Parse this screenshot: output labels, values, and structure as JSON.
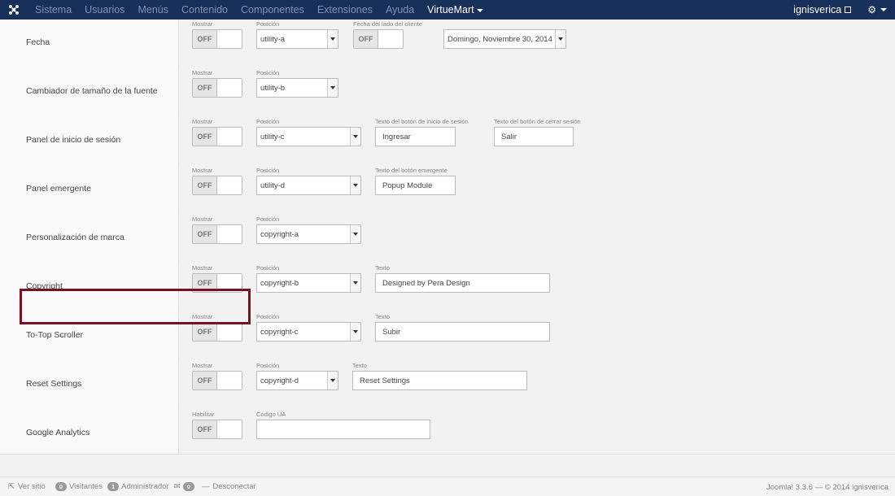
{
  "navbar": {
    "items": [
      "Sistema",
      "Usuarios",
      "Menús",
      "Contenido",
      "Componentes",
      "Extensiones",
      "Ayuda"
    ],
    "active_item": "VirtueMart",
    "user": "ignisverica",
    "bg": "#17305a"
  },
  "labels": {
    "mostrar": "Mostrar",
    "posicion": "Posición",
    "texto": "Texto",
    "habilitar": "Habilitar",
    "off": "OFF"
  },
  "rows": [
    {
      "label": "Fecha",
      "position": "utility-a",
      "extra_label": "Fecha del lado del cliente",
      "date_value": "Domingo, Noviembre 30, 2014"
    },
    {
      "label": "Cambiador de tamaño de la fuente",
      "position": "utility-b"
    },
    {
      "label": "Panel de inicio de sesión",
      "position": "utility-c",
      "login_label": "Texto del botón de inicio de sesión",
      "login_value": "Ingresar",
      "logout_label": "Texto del botón de cerrar sesión",
      "logout_value": "Salir"
    },
    {
      "label": "Panel emergente",
      "position": "utility-d",
      "popup_label": "Texto del botón emergente",
      "popup_value": "Popup Module"
    },
    {
      "label": "Personalización de marca",
      "position": "copyright-a"
    },
    {
      "label": "Copyright",
      "position": "copyright-b",
      "text_value": "Designed by Pera Design"
    },
    {
      "label": "To-Top Scroller",
      "position": "copyright-c",
      "text_value": "Subir"
    },
    {
      "label": "Reset Settings",
      "position": "copyright-d",
      "text_value": "Reset Settings"
    },
    {
      "label": "Google Analytics",
      "ua_label": "Código UA",
      "ua_value": ""
    }
  ],
  "statusbar": {
    "view_site": "Ver sitio",
    "visitors_count": "0",
    "visitors_label": "Visitantes",
    "admin_count": "1",
    "admin_label": "Administrador",
    "messages_count": "0",
    "logout": "Desconectar",
    "version": "Joomla! 3.3.6 — © 2014 ignisverica"
  },
  "colors": {
    "highlight": "#7a1020"
  }
}
